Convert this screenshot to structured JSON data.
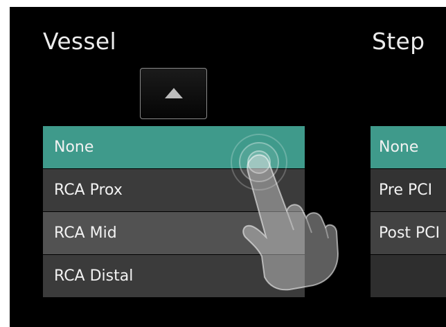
{
  "vessel": {
    "title": "Vessel",
    "items": [
      {
        "label": "None",
        "selected": true
      },
      {
        "label": "RCA Prox",
        "selected": false
      },
      {
        "label": "RCA Mid",
        "selected": false
      },
      {
        "label": "RCA Distal",
        "selected": false
      }
    ]
  },
  "step": {
    "title": "Step",
    "items": [
      {
        "label": "None",
        "selected": true
      },
      {
        "label": "Pre PCI",
        "selected": false
      },
      {
        "label": "Post PCI",
        "selected": false
      },
      {
        "label": "",
        "selected": false
      }
    ]
  },
  "icons": {
    "scroll_up": "triangle-up-icon",
    "touch_hint": "hand-pointer-icon"
  },
  "colors": {
    "background": "#000000",
    "selected_item": "#3f9a8b",
    "item_dark": "#3b3b3b",
    "item_light": "#525252",
    "text": "#f2f2f2"
  }
}
